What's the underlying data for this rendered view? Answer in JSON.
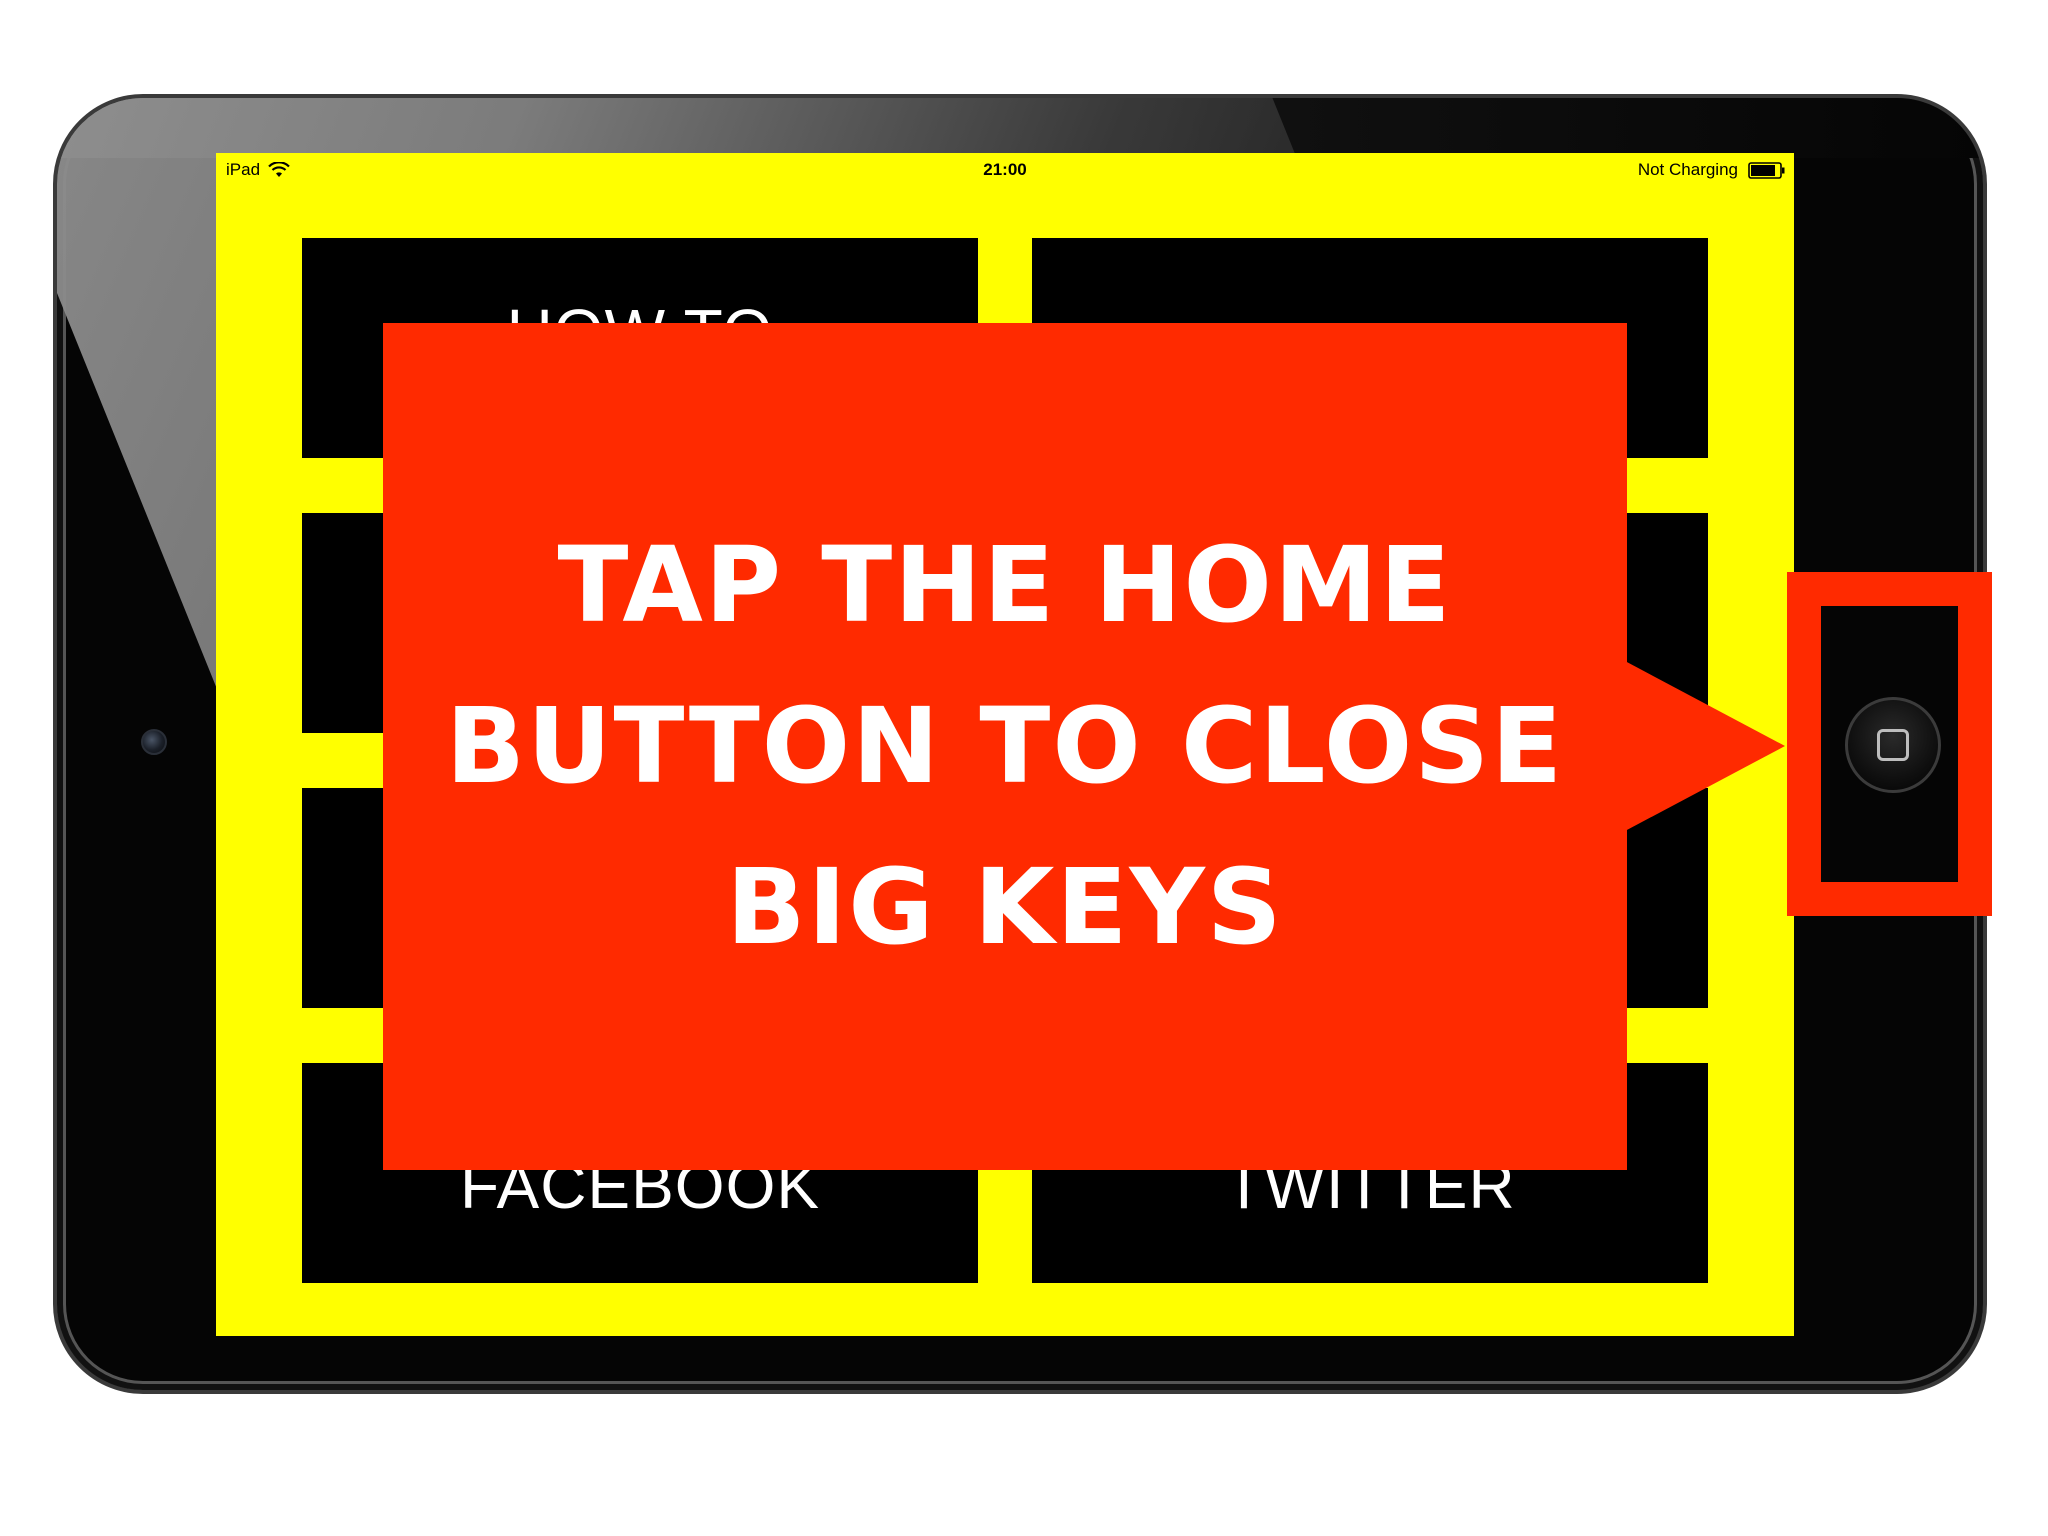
{
  "status_bar": {
    "device": "iPad",
    "time": "21:00",
    "charging": "Not Charging"
  },
  "tiles": [
    {
      "label": "HOW TO"
    },
    {
      "label": ""
    },
    {
      "label": ""
    },
    {
      "label": ""
    },
    {
      "label": ""
    },
    {
      "label": ""
    },
    {
      "label": "FACEBOOK"
    },
    {
      "label": "TWITTER"
    }
  ],
  "callout": {
    "text": "TAP THE HOME\nBUTTON TO CLOSE\nBIG KEYS"
  },
  "colors": {
    "screen_background": "#ffff00",
    "tile_background": "#000000",
    "callout_background": "#ff2a00",
    "callout_text": "#ffffff"
  },
  "icons": {
    "wifi": "wifi-icon",
    "battery": "battery-icon",
    "home": "home-button-icon"
  }
}
